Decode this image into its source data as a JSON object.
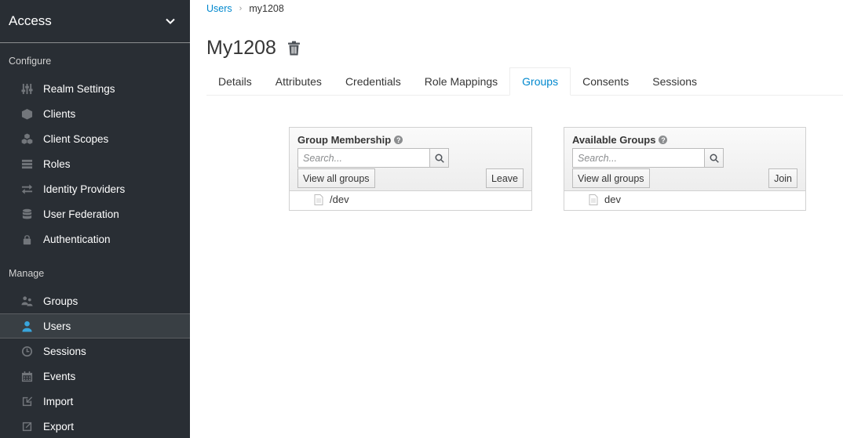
{
  "sidebar": {
    "realm": "Access",
    "configure_heading": "Configure",
    "manage_heading": "Manage",
    "configure_items": [
      {
        "label": "Realm Settings",
        "icon": "sliders-icon"
      },
      {
        "label": "Clients",
        "icon": "cube-icon"
      },
      {
        "label": "Client Scopes",
        "icon": "cubes-icon"
      },
      {
        "label": "Roles",
        "icon": "list-icon"
      },
      {
        "label": "Identity Providers",
        "icon": "exchange-icon"
      },
      {
        "label": "User Federation",
        "icon": "database-icon"
      },
      {
        "label": "Authentication",
        "icon": "lock-icon"
      }
    ],
    "manage_items": [
      {
        "label": "Groups",
        "icon": "users-icon"
      },
      {
        "label": "Users",
        "icon": "user-icon",
        "active": true
      },
      {
        "label": "Sessions",
        "icon": "clock-icon"
      },
      {
        "label": "Events",
        "icon": "calendar-icon"
      },
      {
        "label": "Import",
        "icon": "import-icon"
      },
      {
        "label": "Export",
        "icon": "export-icon"
      }
    ]
  },
  "breadcrumb": {
    "parent": "Users",
    "separator": "›",
    "current": "my1208"
  },
  "page": {
    "title": "My1208"
  },
  "tabs": [
    {
      "label": "Details"
    },
    {
      "label": "Attributes"
    },
    {
      "label": "Credentials"
    },
    {
      "label": "Role Mappings"
    },
    {
      "label": "Groups",
      "active": true
    },
    {
      "label": "Consents"
    },
    {
      "label": "Sessions"
    }
  ],
  "membership": {
    "title": "Group Membership",
    "help": "?",
    "search_placeholder": "Search...",
    "view_all_label": "View all groups",
    "action_label": "Leave",
    "groups": [
      "/dev"
    ]
  },
  "available": {
    "title": "Available Groups",
    "help": "?",
    "search_placeholder": "Search...",
    "view_all_label": "View all groups",
    "action_label": "Join",
    "groups": [
      "dev"
    ]
  },
  "colors": {
    "sidebar_bg": "#292e34",
    "accent": "#0088ce",
    "active_icon": "#39a5dc"
  }
}
